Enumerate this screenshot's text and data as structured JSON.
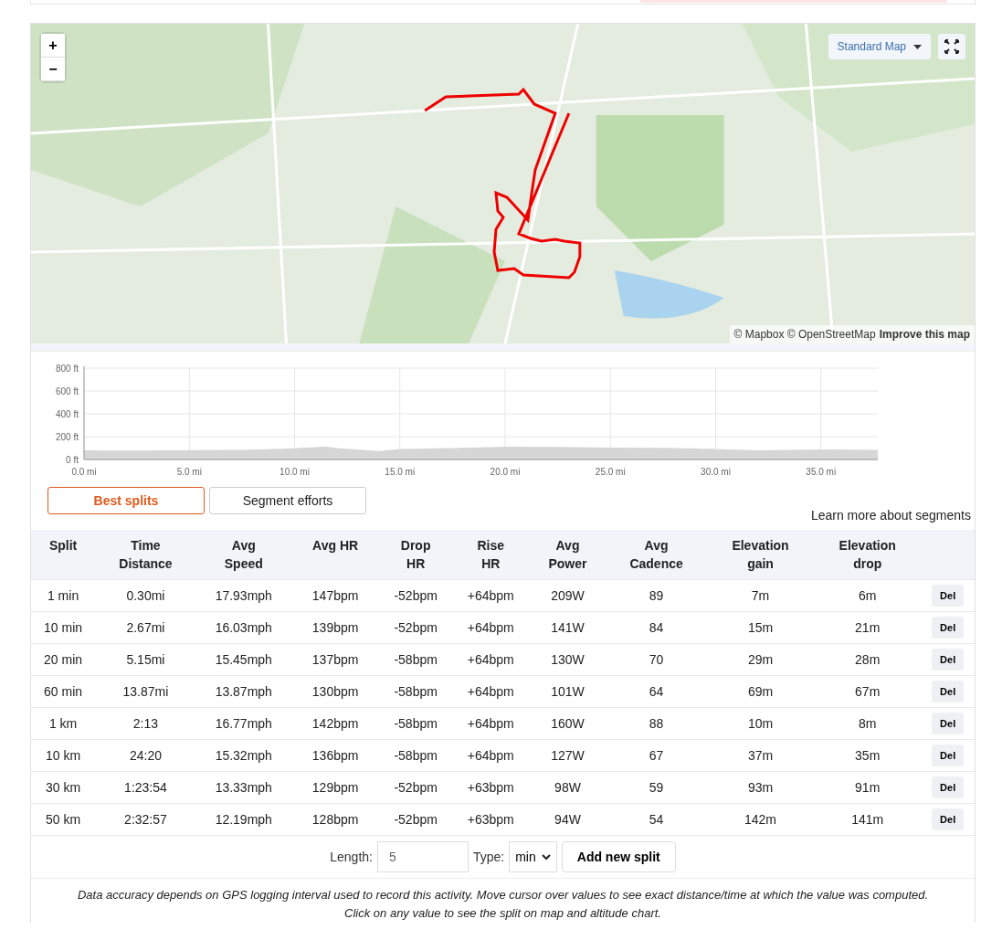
{
  "map": {
    "zoom_in": "+",
    "zoom_out": "−",
    "style_dropdown": "Standard Map",
    "attribution": "© Mapbox © OpenStreetMap",
    "improve_link": "Improve this map"
  },
  "elevation": {
    "chart_data": {
      "type": "area",
      "grid": true,
      "xlim": [
        0,
        37.7
      ],
      "ylim": [
        0,
        800
      ],
      "xticks": [
        {
          "value": 0,
          "label": "0.0 mi"
        },
        {
          "value": 5,
          "label": "5.0 mi"
        },
        {
          "value": 10,
          "label": "10.0 mi"
        },
        {
          "value": 15,
          "label": "15.0 mi"
        },
        {
          "value": 20,
          "label": "20.0 mi"
        },
        {
          "value": 25,
          "label": "25.0 mi"
        },
        {
          "value": 30,
          "label": "30.0 mi"
        },
        {
          "value": 35,
          "label": "35.0 mi"
        }
      ],
      "yticks": [
        {
          "value": 0,
          "label": "0 ft"
        },
        {
          "value": 200,
          "label": "200 ft"
        },
        {
          "value": 400,
          "label": "400 ft"
        },
        {
          "value": 600,
          "label": "600 ft"
        },
        {
          "value": 800,
          "label": "800 ft"
        }
      ],
      "x": [
        0,
        2.5,
        5,
        7.5,
        10,
        11.5,
        12,
        14,
        15,
        17.5,
        20,
        22.5,
        25,
        27.5,
        30,
        32,
        35,
        37.7
      ],
      "series": [
        {
          "color": "#d6d6d6",
          "values": [
            80,
            78,
            82,
            85,
            98,
            115,
            100,
            75,
            92,
            100,
            112,
            110,
            105,
            102,
            92,
            80,
            88,
            85
          ]
        }
      ]
    }
  },
  "tabs": [
    {
      "label": "Best splits",
      "selected": true
    },
    {
      "label": "Segment efforts",
      "selected": false
    }
  ],
  "segments_link": "Learn more about segments",
  "table": {
    "columns": [
      "Split",
      "Time\nDistance",
      "Avg\nSpeed",
      "Avg HR",
      "Drop\nHR",
      "Rise\nHR",
      "Avg\nPower",
      "Avg\nCadence",
      "Elevation\ngain",
      "Elevation\ndrop"
    ],
    "rows": [
      {
        "cells": [
          "1 min",
          "0.30mi",
          "17.93mph",
          "147bpm",
          "-52bpm",
          "+64bpm",
          "209W",
          "89",
          "7m",
          "6m"
        ],
        "action": "Del"
      },
      {
        "cells": [
          "10 min",
          "2.67mi",
          "16.03mph",
          "139bpm",
          "-52bpm",
          "+64bpm",
          "141W",
          "84",
          "15m",
          "21m"
        ],
        "action": "Del"
      },
      {
        "cells": [
          "20 min",
          "5.15mi",
          "15.45mph",
          "137bpm",
          "-58bpm",
          "+64bpm",
          "130W",
          "70",
          "29m",
          "28m"
        ],
        "action": "Del"
      },
      {
        "cells": [
          "60 min",
          "13.87mi",
          "13.87mph",
          "130bpm",
          "-58bpm",
          "+64bpm",
          "101W",
          "64",
          "69m",
          "67m"
        ],
        "action": "Del"
      },
      {
        "cells": [
          "1 km",
          "2:13",
          "16.77mph",
          "142bpm",
          "-58bpm",
          "+64bpm",
          "160W",
          "88",
          "10m",
          "8m"
        ],
        "action": "Del"
      },
      {
        "cells": [
          "10 km",
          "24:20",
          "15.32mph",
          "136bpm",
          "-58bpm",
          "+64bpm",
          "127W",
          "67",
          "37m",
          "35m"
        ],
        "action": "Del"
      },
      {
        "cells": [
          "30 km",
          "1:23:54",
          "13.33mph",
          "129bpm",
          "-52bpm",
          "+63bpm",
          "98W",
          "59",
          "93m",
          "91m"
        ],
        "action": "Del"
      },
      {
        "cells": [
          "50 km",
          "2:32:57",
          "12.19mph",
          "128bpm",
          "-52bpm",
          "+63bpm",
          "94W",
          "54",
          "142m",
          "141m"
        ],
        "action": "Del"
      }
    ]
  },
  "add_split": {
    "length_label": "Length:",
    "length_value": "5",
    "type_label": "Type:",
    "type_value": "min",
    "button": "Add new split"
  },
  "note": "Data accuracy depends on GPS logging interval used to record this activity. Move cursor over values to see exact distance/time at which the value was computed. Click on any value to see the split on map and altitude chart."
}
